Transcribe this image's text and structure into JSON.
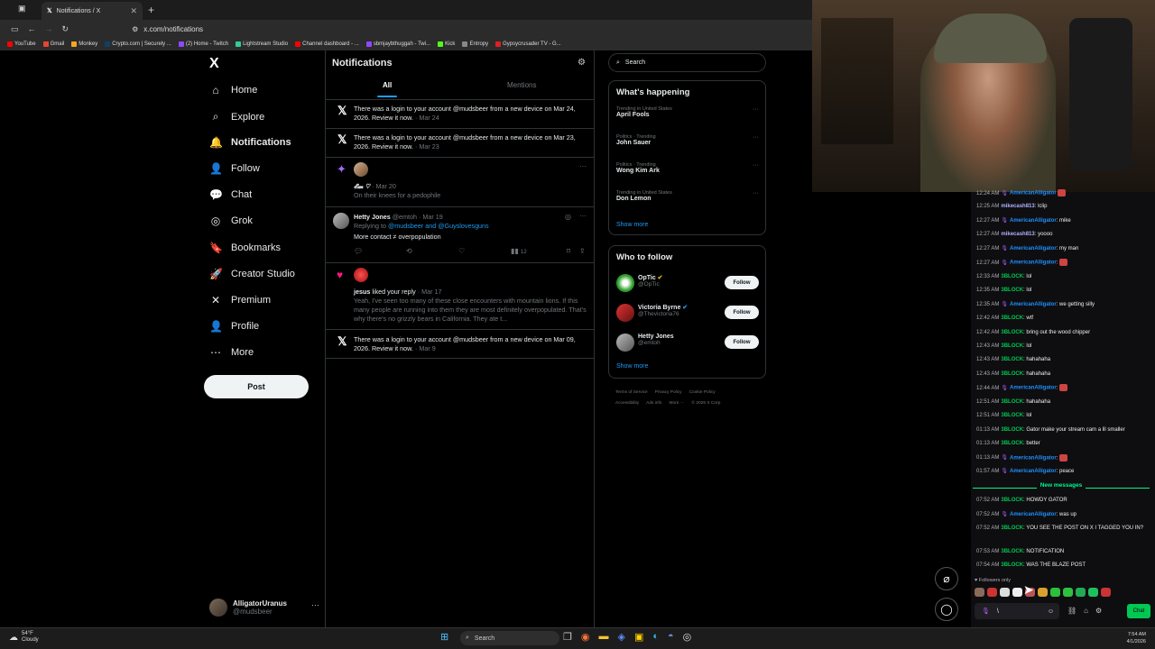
{
  "browser": {
    "tab_title": "Notifications / X",
    "url": "x.com/notifications",
    "bookmarks": [
      {
        "label": "YouTube",
        "color": "#ff0000"
      },
      {
        "label": "Gmail",
        "color": "#ea4335"
      },
      {
        "label": "Monkey",
        "color": "#f5a623"
      },
      {
        "label": "Crypto.com | Securely ...",
        "color": "#103f68"
      },
      {
        "label": "(2) Home - Twitch",
        "color": "#9146ff"
      },
      {
        "label": "Lightstream Studio",
        "color": "#33cc99"
      },
      {
        "label": "Channel dashboard - ...",
        "color": "#ff0000"
      },
      {
        "label": "sbmjaybthuggah - Twi...",
        "color": "#9146ff"
      },
      {
        "label": "Kick",
        "color": "#53fc18"
      },
      {
        "label": "Entropy",
        "color": "#888888"
      },
      {
        "label": "Gypsycrusader TV - G...",
        "color": "#e02020"
      }
    ]
  },
  "sidebar": {
    "logo": "X",
    "items": [
      {
        "label": "Home",
        "icon": "home-icon",
        "glyph": "⌂"
      },
      {
        "label": "Explore",
        "icon": "search-icon",
        "glyph": "⌕"
      },
      {
        "label": "Notifications",
        "icon": "bell-icon",
        "glyph": "🔔"
      },
      {
        "label": "Follow",
        "icon": "follow-icon",
        "glyph": "👤"
      },
      {
        "label": "Chat",
        "icon": "chat-icon",
        "glyph": "💬"
      },
      {
        "label": "Grok",
        "icon": "grok-icon",
        "glyph": "◎"
      },
      {
        "label": "Bookmarks",
        "icon": "bookmark-icon",
        "glyph": "🔖"
      },
      {
        "label": "Creator Studio",
        "icon": "rocket-icon",
        "glyph": "🚀"
      },
      {
        "label": "Premium",
        "icon": "x-icon",
        "glyph": "✕"
      },
      {
        "label": "Profile",
        "icon": "profile-icon",
        "glyph": "👤"
      },
      {
        "label": "More",
        "icon": "more-icon",
        "glyph": "⋯"
      }
    ],
    "post_label": "Post",
    "account": {
      "name": "AlligatorUranus",
      "handle": "@mudsbeer"
    }
  },
  "notifications": {
    "title": "Notifications",
    "tabs": [
      "All",
      "Mentions"
    ],
    "items": [
      {
        "text": "There was a login to your account @mudsbeer from a new device on Mar 24, 2026. Review it now.",
        "date": "· Mar 24"
      },
      {
        "text": "There was a login to your account @mudsbeer from a new device on Mar 23, 2026. Review it now.",
        "date": "· Mar 23"
      },
      {
        "user": "𝓔𝓶 ♡",
        "date": "· Mar 20",
        "text": "On their knees for a pedophile"
      },
      {
        "user": "Hetty Jones",
        "handle": "@emtoh",
        "date": "· Mar 19",
        "reply_prefix": "Replying to",
        "reply_to": "@mudsbeer and @Guyslovesguns",
        "text": "More contact ≠ overpopulation",
        "views": "12"
      },
      {
        "user": "jesus",
        "action": "liked your reply",
        "date": "· Mar 17",
        "text": "Yeah, I've seen too many of these close encounters with mountain lions. If this many people are running into them they are most definitely overpopulated. That's why there's no grizzly bears in California. They ate t..."
      },
      {
        "text": "There was a login to your account @mudsbeer from a new device on Mar 09, 2026. Review it now.",
        "date": "· Mar 9"
      }
    ]
  },
  "right": {
    "search_placeholder": "Search",
    "happening_title": "What's happening",
    "trends": [
      {
        "context": "Trending in United States",
        "name": "April Fools"
      },
      {
        "context": "Politics · Trending",
        "name": "John Sauer"
      },
      {
        "context": "Politics · Trending",
        "name": "Wong Kim Ark"
      },
      {
        "context": "Trending in United States",
        "name": "Don Lemon"
      }
    ],
    "show_more": "Show more",
    "wtf_title": "Who to follow",
    "follow_label": "Follow",
    "wtf": [
      {
        "name": "OpTic",
        "handle": "@OpTic",
        "verified": "gold"
      },
      {
        "name": "Victoria Byrne",
        "handle": "@Thevictoria76",
        "verified": "blue"
      },
      {
        "name": "Hetty Jones",
        "handle": "@emtoh",
        "verified": ""
      }
    ],
    "footer": [
      "Terms of Service",
      "Privacy Policy",
      "Cookie Policy",
      "Accessibility",
      "Ads info",
      "More ···",
      "© 2026 X Corp."
    ]
  },
  "chat": {
    "messages": [
      {
        "time": "12:24 AM",
        "user": "AmericanAlligator",
        "text": ""
      },
      {
        "time": "12:25 AM",
        "user": "mikecash813",
        "text": ": lclip"
      },
      {
        "time": "12:27 AM",
        "user": "AmericanAlligator",
        "text": ": mike"
      },
      {
        "time": "12:27 AM",
        "user": "mikecash813",
        "text": ": yoooo"
      },
      {
        "time": "12:27 AM",
        "user": "AmericanAlligator",
        "text": ": my man"
      },
      {
        "time": "12:27 AM",
        "user": "AmericanAlligator",
        "text": ":"
      },
      {
        "time": "12:33 AM",
        "user": "3BLOCK",
        "text": ": lol"
      },
      {
        "time": "12:35 AM",
        "user": "3BLOCK",
        "text": ": lol"
      },
      {
        "time": "12:35 AM",
        "user": "AmericanAlligator",
        "text": ": we getting silly"
      },
      {
        "time": "12:42 AM",
        "user": "3BLOCK",
        "text": ": wtf"
      },
      {
        "time": "12:42 AM",
        "user": "3BLOCK",
        "text": ": bring out the wood chipper"
      },
      {
        "time": "12:43 AM",
        "user": "3BLOCK",
        "text": ": lol"
      },
      {
        "time": "12:43 AM",
        "user": "3BLOCK",
        "text": ": hahahaha"
      },
      {
        "time": "12:43 AM",
        "user": "3BLOCK",
        "text": ": hahahaha"
      },
      {
        "time": "12:44 AM",
        "user": "AmericanAlligator",
        "text": ":"
      },
      {
        "time": "12:51 AM",
        "user": "3BLOCK",
        "text": ": hahahaha"
      },
      {
        "time": "12:51 AM",
        "user": "3BLOCK",
        "text": ": lol"
      },
      {
        "time": "01:13 AM",
        "user": "3BLOCK",
        "text": ": Gator make your stream cam a lil smaller"
      },
      {
        "time": "01:13 AM",
        "user": "3BLOCK",
        "text": ": better"
      },
      {
        "time": "01:13 AM",
        "user": "AmericanAlligator",
        "text": ":"
      },
      {
        "time": "01:57 AM",
        "user": "AmericanAlligator",
        "text": ": peace"
      }
    ],
    "new_label": "New messages",
    "new_messages": [
      {
        "time": "07:52 AM",
        "user": "3BLOCK",
        "text": ": HOWDY GATOR"
      },
      {
        "time": "07:52 AM",
        "user": "AmericanAlligator",
        "text": ": was up"
      },
      {
        "time": "07:52 AM",
        "user": "3BLOCK",
        "text": ": YOU SEE THE POST ON X I TAGGED YOU IN?"
      },
      {
        "time": "07:53 AM",
        "user": "3BLOCK",
        "text": ": NOTIFICATION"
      },
      {
        "time": "07:54 AM",
        "user": "3BLOCK",
        "text": ": WAS THE BLAZE POST"
      }
    ],
    "followers_only": "Followers only",
    "input_value": "\\",
    "send_label": "Chat"
  },
  "taskbar": {
    "temp": "54°F",
    "weather": "Cloudy",
    "search_label": "Search",
    "time": "7:54 AM",
    "date": "4/1/2026"
  }
}
